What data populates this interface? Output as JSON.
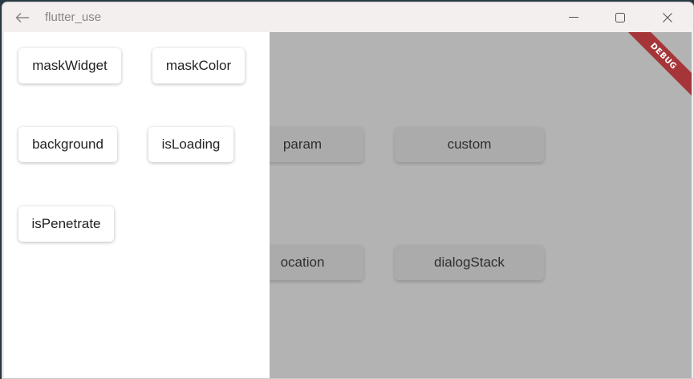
{
  "window": {
    "title": "flutter_use"
  },
  "background_buttons": {
    "param": "param",
    "custom": "custom",
    "location": "ocation",
    "dialog_stack": "dialogStack"
  },
  "drawer": {
    "buttons": {
      "mask_widget": "maskWidget",
      "mask_color": "maskColor",
      "background": "background",
      "is_loading": "isLoading",
      "is_penetrate": "isPenetrate"
    }
  },
  "debug_banner": {
    "label": "DEBUG",
    "color": "#a6353a"
  },
  "icons": {
    "back": "back-arrow-icon",
    "minimize": "minimize-icon",
    "maximize": "maximize-icon",
    "close": "close-icon"
  }
}
